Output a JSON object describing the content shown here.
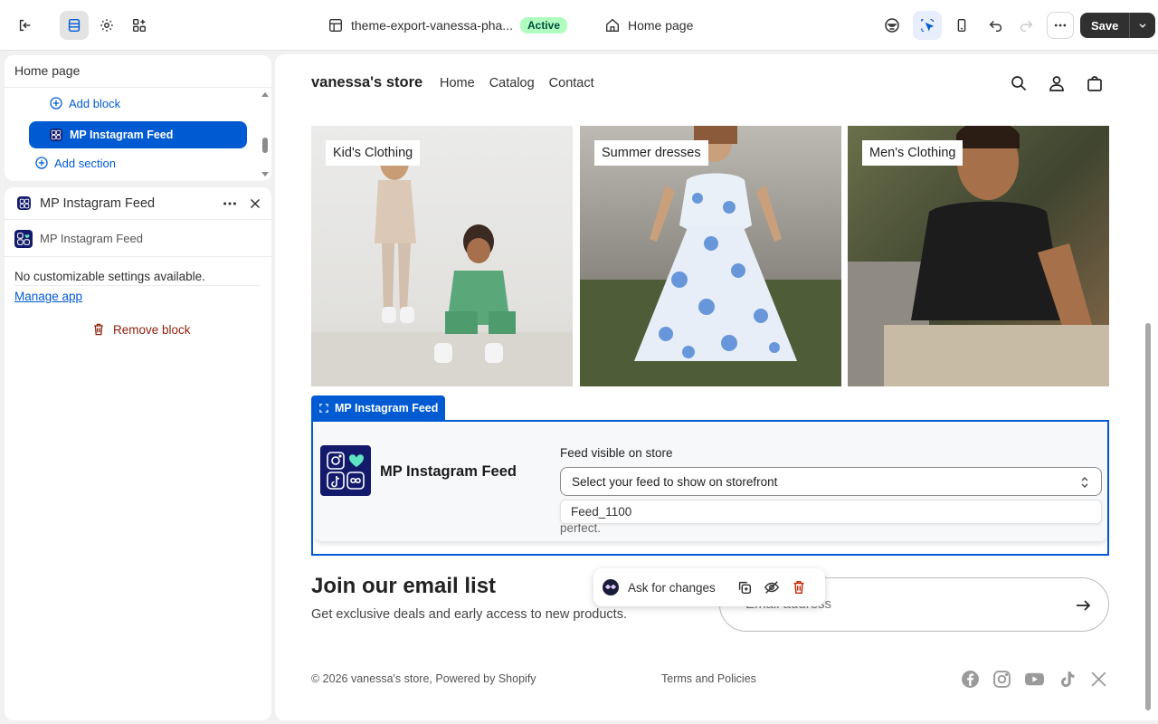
{
  "topbar": {
    "theme_name": "theme-export-vanessa-pha...",
    "theme_status": "Active",
    "page_name": "Home page",
    "save_label": "Save"
  },
  "sidebar": {
    "title": "Home page",
    "add_block": "Add block",
    "selected_block": "MP Instagram Feed",
    "add_section": "Add section"
  },
  "inspector": {
    "title": "MP Instagram Feed",
    "app_name": "MP Instagram Feed",
    "message": "No customizable settings available.",
    "manage_link": "Manage app",
    "remove_label": "Remove block"
  },
  "store": {
    "name": "vanessa's store",
    "nav": [
      "Home",
      "Catalog",
      "Contact"
    ],
    "collections": [
      {
        "label": "Kid's Clothing"
      },
      {
        "label": "Summer dresses"
      },
      {
        "label": "Men's Clothing"
      }
    ],
    "selection_tab": "MP Instagram Feed",
    "feed": {
      "app_title": "MP Instagram Feed",
      "field_label": "Feed visible on store",
      "select_placeholder": "Select your feed to show on storefront",
      "option": "Feed_1100",
      "behind_text": "perfect."
    },
    "newsletter": {
      "title": "Join our email list",
      "subtitle": "Get exclusive deals and early access to new products.",
      "placeholder": "Email address"
    },
    "ask_label": "Ask for changes",
    "footer": {
      "copyright": "© 2026 vanessa's store, Powered by Shopify",
      "terms": "Terms and Policies"
    }
  },
  "colors": {
    "accent": "#005bd3",
    "active_badge": "#affebf",
    "remove": "#8e1f0b",
    "save": "#303030"
  }
}
